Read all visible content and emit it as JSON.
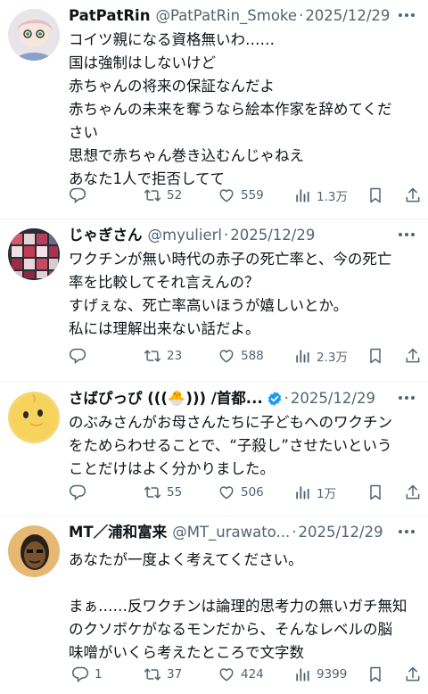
{
  "tweets": [
    {
      "name": "PatPatRin",
      "handle": "@PatPatRin_Smoke",
      "date": "2025/12/29",
      "lines": [
        "コイツ親になる資格無いわ……",
        "国は強制はしないけど",
        "赤ちゃんの将来の保証なんだよ",
        "赤ちゃんの未来を奪うなら絵本作家を辞めてくだ",
        "さい",
        "思想で赤ちゃん巻き込むんじゃねえ",
        "あなた1人で拒否してて"
      ],
      "reply_count": "",
      "retweet_count": "52",
      "like_count": "559",
      "view_count": "1.3万"
    },
    {
      "name": "じゃぎさん",
      "handle": "@myulierl",
      "date": "2025/12/29",
      "lines": [
        "ワクチンが無い時代の赤子の死亡率と、今の死亡",
        "率を比較してそれ言えんの？",
        "すげぇな、死亡率高いほうが嬉しいとか。",
        "私には理解出来ない話だよ。"
      ],
      "reply_count": "",
      "retweet_count": "23",
      "like_count": "588",
      "view_count": "2.3万"
    },
    {
      "name": "さばぴっぴ (((🐣))) /首都...",
      "handle": "",
      "date": "2025/12/29",
      "lines": [
        "のぶみさんがお母さんたちに子どもへのワクチン",
        "をためらわせることで、“子殺し”させたいという",
        "ことだけはよく分かりました。"
      ],
      "reply_count": "",
      "retweet_count": "55",
      "like_count": "506",
      "view_count": "1万"
    },
    {
      "name": "MT／浦和富来",
      "handle": "@MT_urawato...",
      "date": "2025/12/29",
      "lines": [
        "あなたが一度よく考えてください。",
        "",
        "まぁ……反ワクチンは論理的思考力の無いガチ無知",
        "のクソボケがなるモンだから、そんなレベルの脳",
        "味噌がいくら考えたところで文字数"
      ],
      "reply_count": "1",
      "retweet_count": "37",
      "like_count": "424",
      "view_count": "9399"
    }
  ],
  "colors": {
    "text": "#0f1419",
    "secondary": "#536471",
    "divider": "#eff3f4",
    "verified": "#1d9bf0"
  },
  "icons": [
    "reply-icon",
    "retweet-icon",
    "like-icon",
    "views-icon",
    "bookmark-icon",
    "share-icon",
    "more-icon",
    "verified-icon"
  ]
}
